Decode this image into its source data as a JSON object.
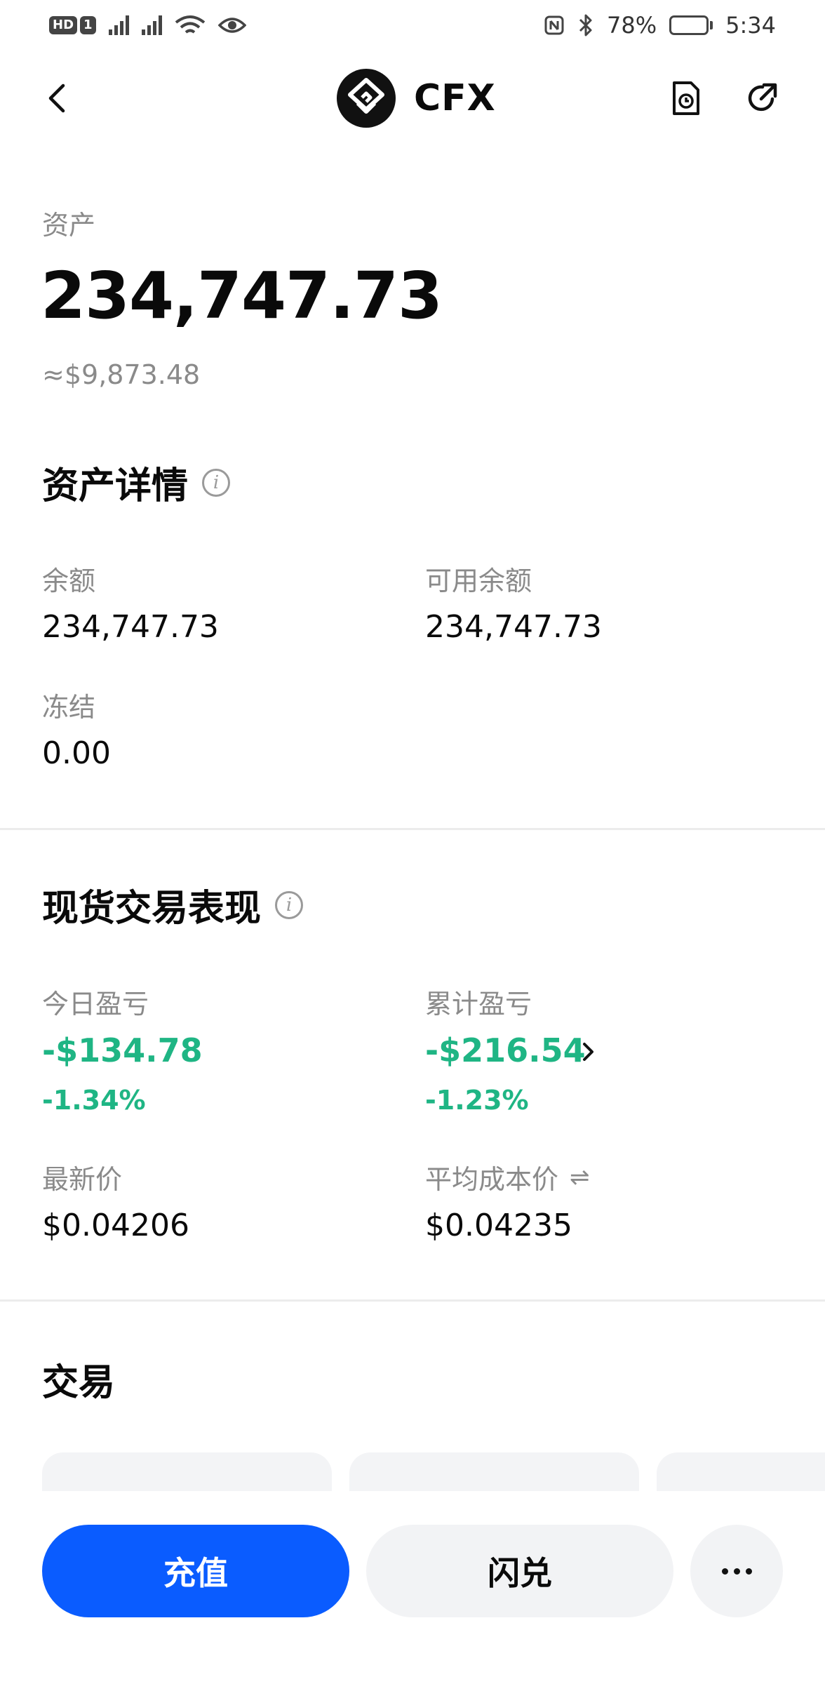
{
  "status_bar": {
    "hd_label": "HD",
    "sim": "1",
    "battery": "78%",
    "battery_level": 0.78,
    "time": "5:34"
  },
  "header": {
    "title": "CFX",
    "icons": {
      "back": "chevron-left-icon",
      "history": "history-icon",
      "share": "share-icon"
    }
  },
  "asset": {
    "label": "资产",
    "value": "234,747.73",
    "usd": "≈$9,873.48"
  },
  "asset_details": {
    "title": "资产详情",
    "info_glyph": "i",
    "balance_label": "余额",
    "balance_value": "234,747.73",
    "available_label": "可用余额",
    "available_value": "234,747.73",
    "frozen_label": "冻结",
    "frozen_value": "0.00"
  },
  "spot_performance": {
    "title": "现货交易表现",
    "info_glyph": "i",
    "today_pnl_label": "今日盈亏",
    "today_pnl_value": "-$134.78",
    "today_pnl_pct": "-1.34%",
    "total_pnl_label": "累计盈亏",
    "total_pnl_value": "-$216.54",
    "total_pnl_pct": "-1.23%",
    "last_price_label": "最新价",
    "last_price_value": "$0.04206",
    "avg_cost_label": "平均成本价",
    "avg_cost_value": "$0.04235",
    "swap_glyph": "⇌"
  },
  "trade": {
    "title": "交易"
  },
  "actions": {
    "deposit_label": "充值",
    "convert_label": "闪兑"
  },
  "colors": {
    "primary": "#0a5cff",
    "loss": "#1fb584",
    "muted_text": "#8a8a8a",
    "surface": "#f2f3f5"
  }
}
